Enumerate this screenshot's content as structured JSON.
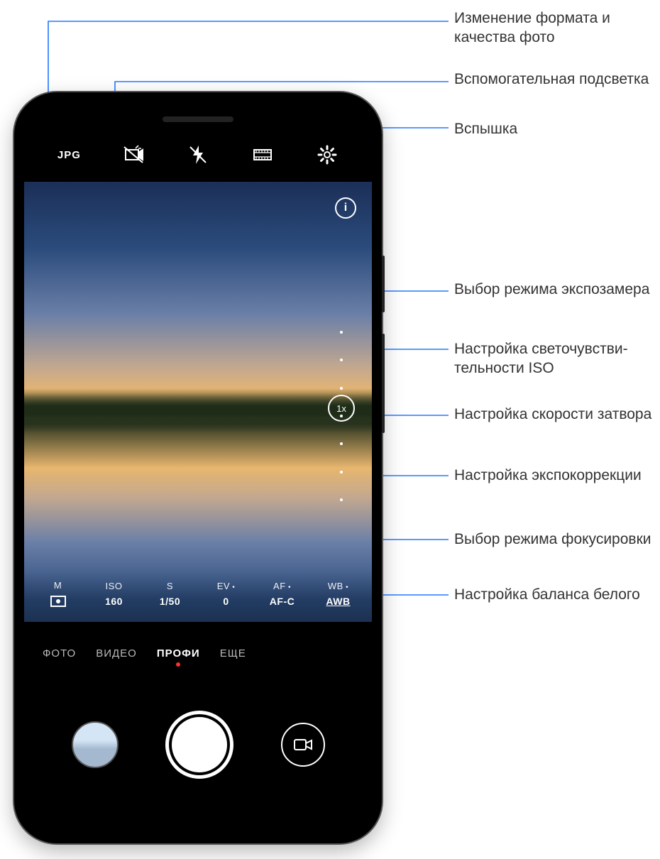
{
  "callouts": {
    "format": "Изменение формата и качества фото",
    "assist_light": "Вспомогательная подсветка",
    "flash": "Вспышка",
    "metering": "Выбор режима экспозамера",
    "iso": "Настройка светочувстви-\nтельности ISO",
    "shutter": "Настройка скорости затвора",
    "ev": "Настройка экспокоррекции",
    "af": "Выбор режима фокусировки",
    "wb": "Настройка баланса белого"
  },
  "topbar": {
    "format_label": "JPG"
  },
  "viewfinder": {
    "info_icon": "i",
    "zoom_label": "1x"
  },
  "pro_params": {
    "m": {
      "label": "M",
      "value_icon": "metering"
    },
    "iso": {
      "label": "ISO",
      "value": "160"
    },
    "s": {
      "label": "S",
      "value": "1/50"
    },
    "ev": {
      "label": "EV",
      "value": "0"
    },
    "af": {
      "label": "AF",
      "value": "AF-C"
    },
    "wb": {
      "label": "WB",
      "value": "AWB"
    }
  },
  "modes": {
    "photo": "ФОТО",
    "video": "ВИДЕО",
    "pro": "ПРОФИ",
    "more": "ЕЩЕ"
  }
}
